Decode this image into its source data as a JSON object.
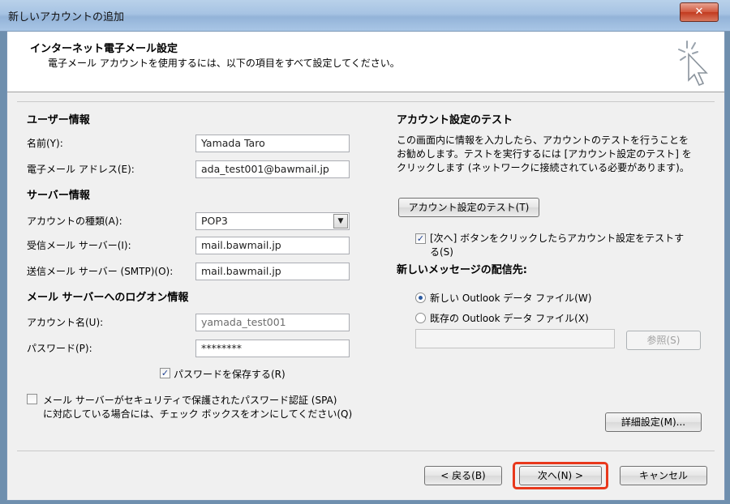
{
  "window": {
    "title": "新しいアカウントの追加",
    "close_label": "✕"
  },
  "header": {
    "title": "インターネット電子メール設定",
    "subtitle": "電子メール アカウントを使用するには、以下の項目をすべて設定してください。"
  },
  "user_info": {
    "section": "ユーザー情報",
    "name_label": "名前(Y):",
    "name_value": "Yamada Taro",
    "email_label": "電子メール アドレス(E):",
    "email_value": "ada_test001@bawmail.jp"
  },
  "server_info": {
    "section": "サーバー情報",
    "account_type_label": "アカウントの種類(A):",
    "account_type_value": "POP3",
    "incoming_label": "受信メール サーバー(I):",
    "incoming_value": "mail.bawmail.jp",
    "outgoing_label": "送信メール サーバー (SMTP)(O):",
    "outgoing_value": "mail.bawmail.jp"
  },
  "logon_info": {
    "section": "メール サーバーへのログオン情報",
    "account_name_label": "アカウント名(U):",
    "account_name_value": "yamada_test001",
    "password_label": "パスワード(P):",
    "password_value": "********",
    "remember_password_label": "パスワードを保存する(R)",
    "remember_password_checked": true,
    "spa_label_line1": "メール サーバーがセキュリティで保護されたパスワード認証 (SPA)",
    "spa_label_line2": "に対応している場合には、チェック ボックスをオンにしてください(Q)",
    "spa_checked": false
  },
  "test_panel": {
    "section": "アカウント設定のテスト",
    "description": "この画面内に情報を入力したら、アカウントのテストを行うことを\nお勧めします。テストを実行するには [アカウント設定のテスト] を\nクリックします (ネットワークに接続されている必要があります)。",
    "test_button": "アカウント設定のテスト(T)",
    "auto_test_label_line1": "[次へ] ボタンをクリックしたらアカウント設定をテストす",
    "auto_test_label_line2": "る(S)",
    "auto_test_checked": true
  },
  "delivery": {
    "section": "新しいメッセージの配信先:",
    "new_file_label": "新しい Outlook データ ファイル(W)",
    "existing_file_label": "既存の Outlook データ ファイル(X)",
    "selected": "new",
    "path_value": "",
    "browse_button": "参照(S)"
  },
  "more_settings_button": "詳細設定(M)...",
  "footer": {
    "back_button": "< 戻る(B)",
    "next_button": "次へ(N) >",
    "cancel_button": "キャンセル"
  },
  "colors": {
    "highlight": "#e8381c",
    "titlebar": "#a6c3e3"
  }
}
